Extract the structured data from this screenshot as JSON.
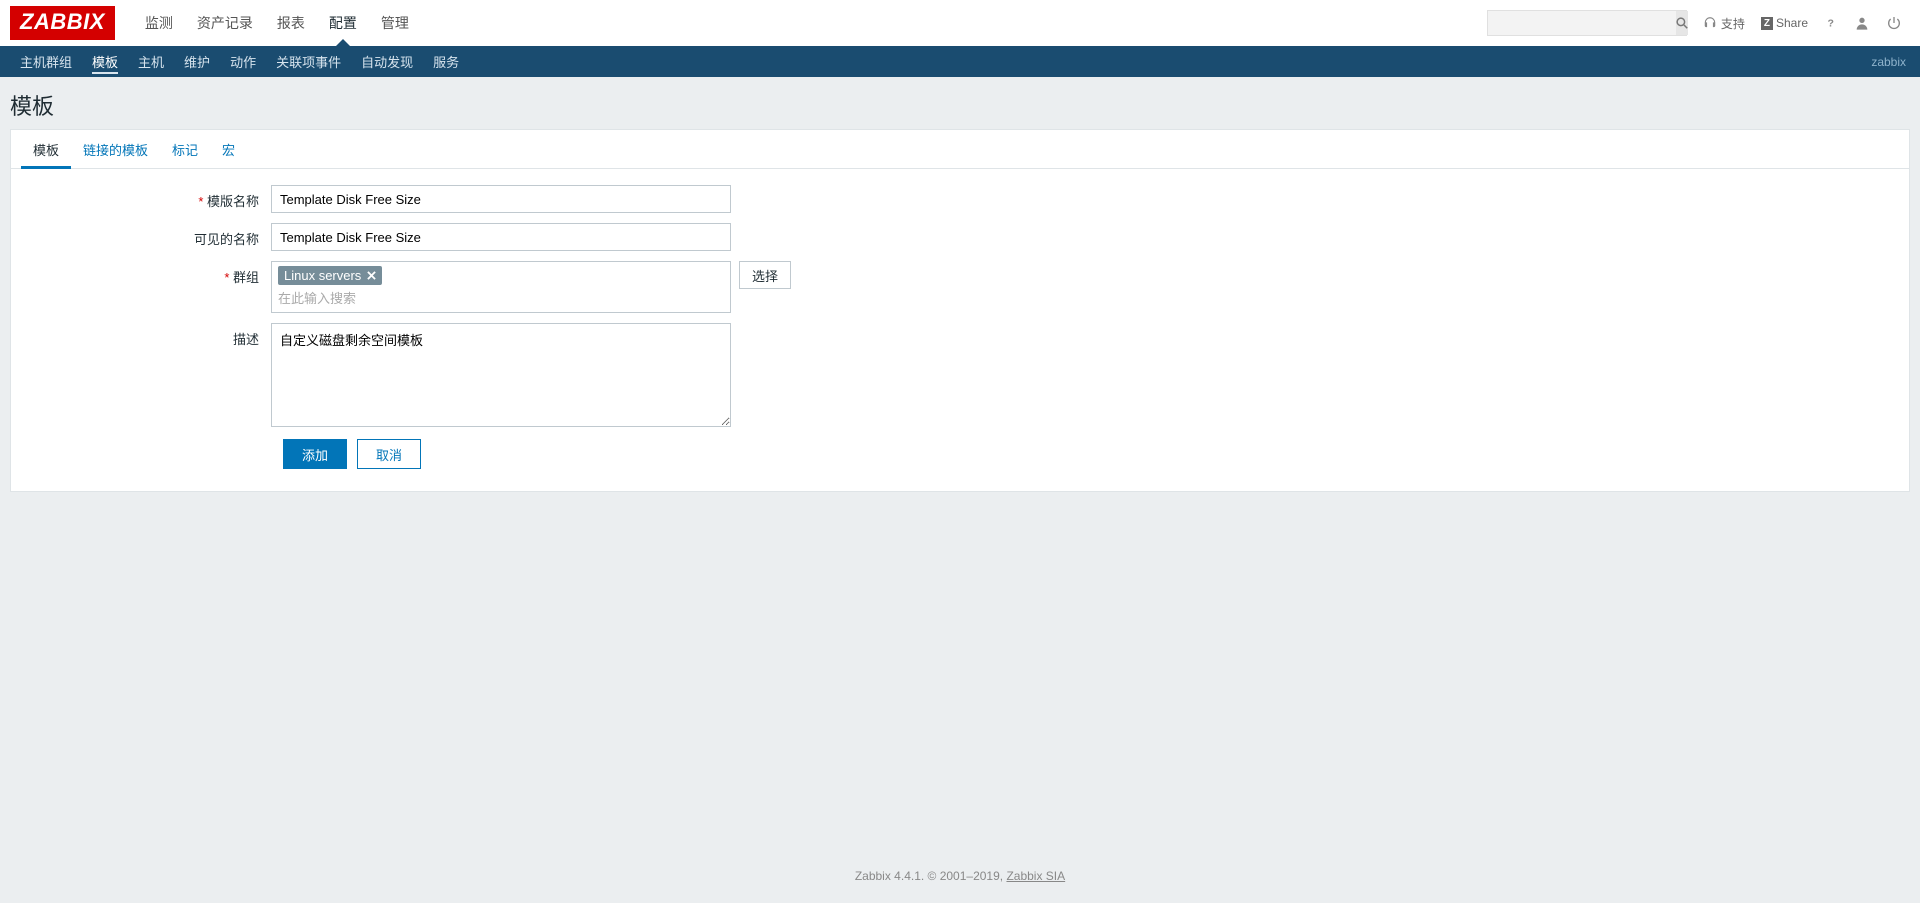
{
  "logo": "ZABBIX",
  "mainNav": {
    "items": [
      "监测",
      "资产记录",
      "报表",
      "配置",
      "管理"
    ],
    "activeIndex": 3
  },
  "headerRight": {
    "support": "支持",
    "share": "Share"
  },
  "subNav": {
    "items": [
      "主机群组",
      "模板",
      "主机",
      "维护",
      "动作",
      "关联项事件",
      "自动发现",
      "服务"
    ],
    "activeIndex": 1,
    "right": "zabbix"
  },
  "pageTitle": "模板",
  "tabs": {
    "items": [
      "模板",
      "链接的模板",
      "标记",
      "宏"
    ],
    "activeIndex": 0
  },
  "form": {
    "labels": {
      "templateName": "模版名称",
      "visibleName": "可见的名称",
      "groups": "群组",
      "description": "描述"
    },
    "values": {
      "templateName": "Template Disk Free Size",
      "visibleName": "Template Disk Free Size",
      "groupTag": "Linux servers",
      "groupSearchPlaceholder": "在此输入搜索",
      "description": "自定义磁盘剩余空间模板"
    },
    "buttons": {
      "select": "选择",
      "add": "添加",
      "cancel": "取消"
    }
  },
  "footer": {
    "text": "Zabbix 4.4.1. © 2001–2019, ",
    "link": "Zabbix SIA"
  }
}
